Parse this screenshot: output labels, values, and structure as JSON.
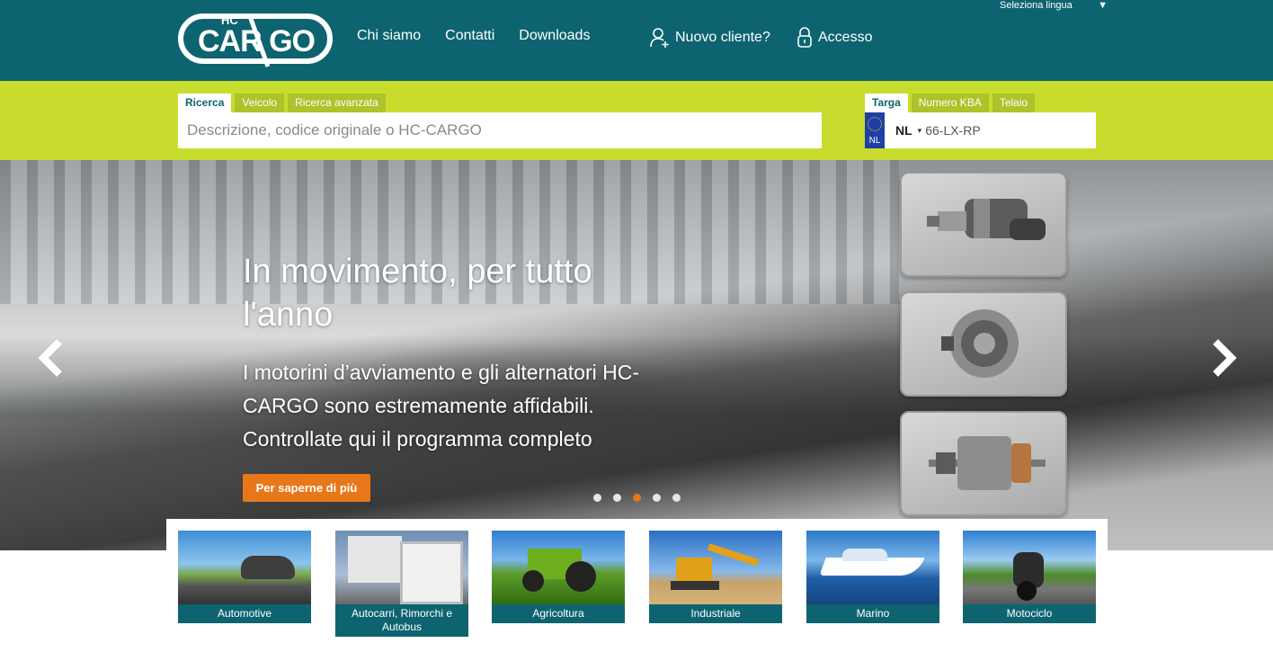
{
  "header": {
    "logo_text": "CAR GO",
    "logo_prefix": "HC",
    "nav": [
      "Chi siamo",
      "Contatti",
      "Downloads"
    ],
    "new_customer": "Nuovo cliente?",
    "login": "Accesso",
    "language_label": "Seleziona lingua",
    "language_caret": "▼"
  },
  "search": {
    "tabs": [
      "Ricerca",
      "Veicolo",
      "Ricerca avanzata"
    ],
    "active_tab": "Ricerca",
    "placeholder": "Descrizione, codice originale o HC-CARGO"
  },
  "plate": {
    "tabs": [
      "Targa",
      "Numero KBA",
      "Telaio"
    ],
    "active_tab": "Targa",
    "eu_code": "NL",
    "country": "NL",
    "caret": "▾",
    "number": "66-LX-RP"
  },
  "hero": {
    "title": "In movimento, per tutto l'anno",
    "text": "I motorini d’avviamento e gli alternatori HC-CARGO sono estremamente affidabili. Controllate qui il programma completo",
    "button": "Per saperne di più",
    "slide_count": 5,
    "active_slide": 3,
    "parts": [
      "starter-motor-image",
      "alternator-image",
      "armature-image"
    ]
  },
  "categories": [
    "Automotive",
    "Autocarri, Rimorchi e Autobus",
    "Agricoltura",
    "Industriale",
    "Marino",
    "Motociclo"
  ],
  "colors": {
    "header": "#0d6470",
    "search_band": "#c8dc2d",
    "accent": "#e8771a"
  }
}
